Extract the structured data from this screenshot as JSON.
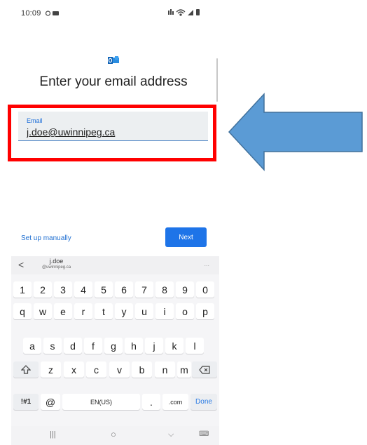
{
  "status": {
    "time": "10:09"
  },
  "header": {
    "title": "Enter your email address"
  },
  "email": {
    "label": "Email",
    "value": "j.doe@uwinnipeg.ca"
  },
  "actions": {
    "setup_manually": "Set up manually",
    "next": "Next"
  },
  "suggestion": {
    "back": "<",
    "line1": "j.doe",
    "line2": "@uwinnipeg.ca",
    "more": "..."
  },
  "keyboard": {
    "row1": [
      "1",
      "2",
      "3",
      "4",
      "5",
      "6",
      "7",
      "8",
      "9",
      "0"
    ],
    "row2": [
      "q",
      "w",
      "e",
      "r",
      "t",
      "y",
      "u",
      "i",
      "o",
      "p"
    ],
    "row3": [
      "a",
      "s",
      "d",
      "f",
      "g",
      "h",
      "j",
      "k",
      "l"
    ],
    "row4": [
      "z",
      "x",
      "c",
      "v",
      "b",
      "n",
      "m"
    ],
    "symbols": "!#1",
    "at": "@",
    "space": "EN(US)",
    "period": ".",
    "dotcom": ".com",
    "done": "Done"
  },
  "navbar": {
    "recents": "|||",
    "home": "○",
    "back": "⌵",
    "keyboard_toggle": "⌨"
  },
  "colors": {
    "accent": "#1e74e8",
    "highlight": "#ff0000",
    "arrow": "#5b9bd5"
  }
}
